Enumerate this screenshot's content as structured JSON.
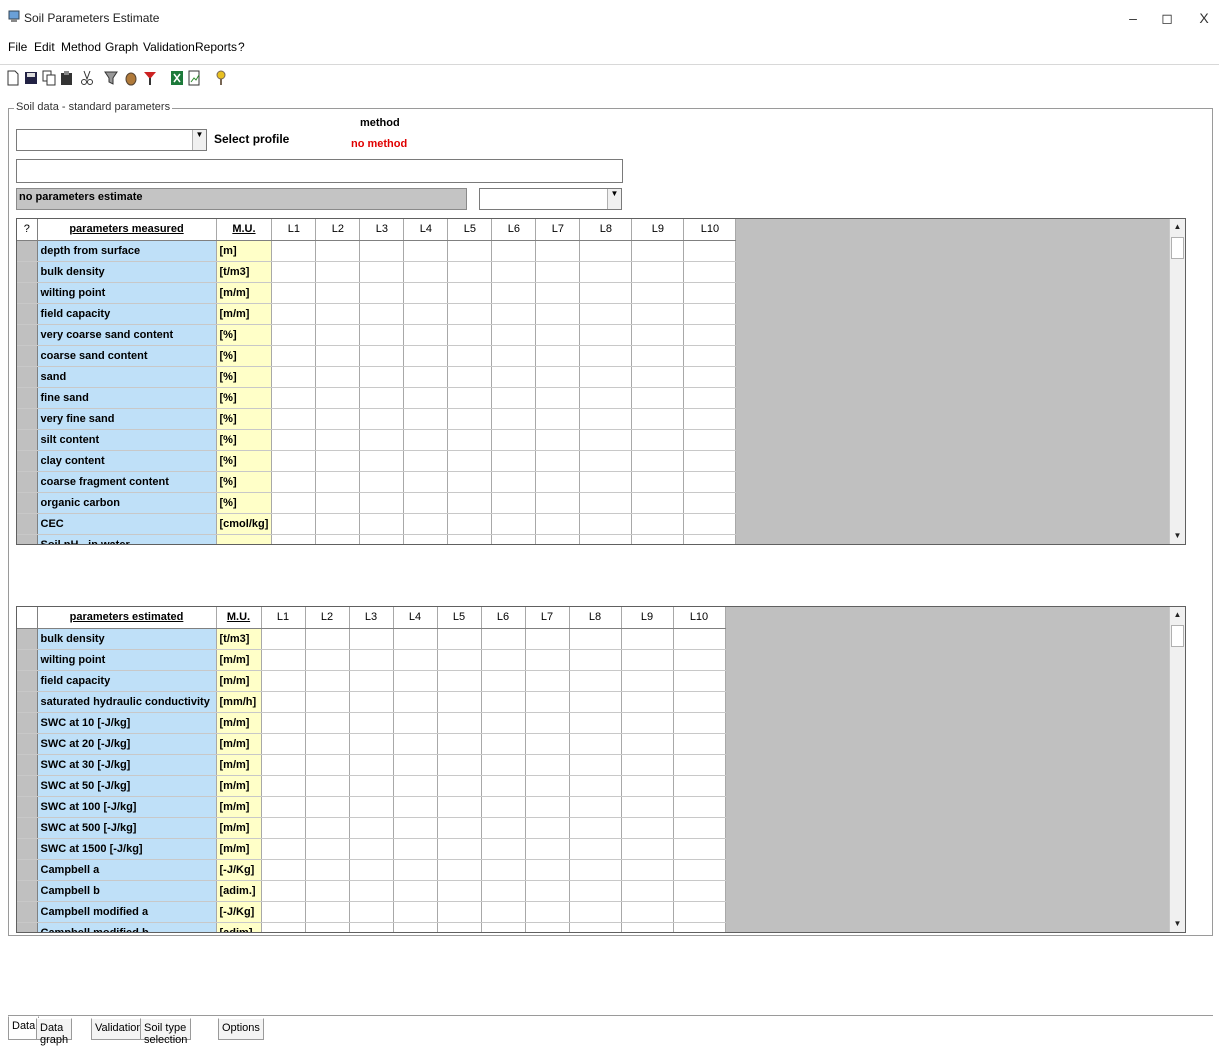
{
  "window": {
    "title": "Soil Parameters Estimate",
    "minimize": "–",
    "maximize": "◻",
    "close": "X"
  },
  "menu": [
    "File",
    "Edit",
    "Method",
    "Graph",
    "Validation",
    "Reports",
    "?"
  ],
  "toolbar_icons": [
    "new-icon",
    "save-icon",
    "copy-icon",
    "paste-icon",
    "cut-icon",
    "filter-icon",
    "soil-icon",
    "chart-icon",
    "excel-icon",
    "report-icon",
    "help-icon"
  ],
  "group": {
    "legend": "Soil data - standard parameters",
    "profile_value": "",
    "select_profile_label": "Select profile",
    "method_label": "method",
    "method_value": "no method",
    "description_value": "",
    "status_text": "no parameters estimate",
    "estimate_combo_value": ""
  },
  "colors": {
    "param_name_bg": "#bfe0f8",
    "unit_bg": "#ffffc8",
    "method_value": "#e00000",
    "grid_empty": "#c0c0c0"
  },
  "measured": {
    "corner": "?",
    "header": "parameters measured",
    "mu_header": "M.U.",
    "layers": [
      "L1",
      "L2",
      "L3",
      "L4",
      "L5",
      "L6",
      "L7",
      "L8",
      "L9",
      "L10"
    ],
    "rows": [
      {
        "name": "depth from surface",
        "unit": "[m]"
      },
      {
        "name": "bulk density",
        "unit": "[t/m3]"
      },
      {
        "name": "wilting point",
        "unit": "[m/m]"
      },
      {
        "name": "field capacity",
        "unit": "[m/m]"
      },
      {
        "name": "very coarse sand content",
        "unit": "[%]"
      },
      {
        "name": "coarse sand content",
        "unit": "[%]"
      },
      {
        "name": "sand",
        "unit": "[%]"
      },
      {
        "name": "fine sand",
        "unit": "[%]"
      },
      {
        "name": "very fine sand",
        "unit": "[%]"
      },
      {
        "name": "silt content",
        "unit": "[%]"
      },
      {
        "name": "clay content",
        "unit": "[%]"
      },
      {
        "name": "coarse fragment content",
        "unit": "[%]"
      },
      {
        "name": "organic carbon",
        "unit": "[%]"
      },
      {
        "name": "CEC",
        "unit": "[cmol/kg]"
      },
      {
        "name": "Soil pH - in water",
        "unit": ""
      }
    ]
  },
  "estimated": {
    "header": "parameters estimated",
    "mu_header": "M.U.",
    "layers": [
      "L1",
      "L2",
      "L3",
      "L4",
      "L5",
      "L6",
      "L7",
      "L8",
      "L9",
      "L10"
    ],
    "rows": [
      {
        "name": "bulk density",
        "unit": "[t/m3]"
      },
      {
        "name": "wilting point",
        "unit": "[m/m]"
      },
      {
        "name": "field capacity",
        "unit": "[m/m]"
      },
      {
        "name": "saturated hydraulic conductivity",
        "unit": "[mm/h]"
      },
      {
        "name": "SWC at 10 [-J/kg]",
        "unit": "[m/m]"
      },
      {
        "name": "SWC at 20 [-J/kg]",
        "unit": "[m/m]"
      },
      {
        "name": "SWC at 30 [-J/kg]",
        "unit": "[m/m]"
      },
      {
        "name": "SWC at 50 [-J/kg]",
        "unit": "[m/m]"
      },
      {
        "name": "SWC at 100 [-J/kg]",
        "unit": "[m/m]"
      },
      {
        "name": "SWC at 500 [-J/kg]",
        "unit": "[m/m]"
      },
      {
        "name": "SWC at 1500 [-J/kg]",
        "unit": "[m/m]"
      },
      {
        "name": "Campbell a",
        "unit": "[-J/Kg]"
      },
      {
        "name": "Campbell b",
        "unit": "[adim.]"
      },
      {
        "name": "Campbell modified a",
        "unit": "[-J/Kg]"
      },
      {
        "name": "Campbell modified b",
        "unit": "[adim]"
      }
    ]
  },
  "tabs": [
    "Data",
    "Data graph",
    "Validation",
    "Soil type selection",
    "Options"
  ]
}
